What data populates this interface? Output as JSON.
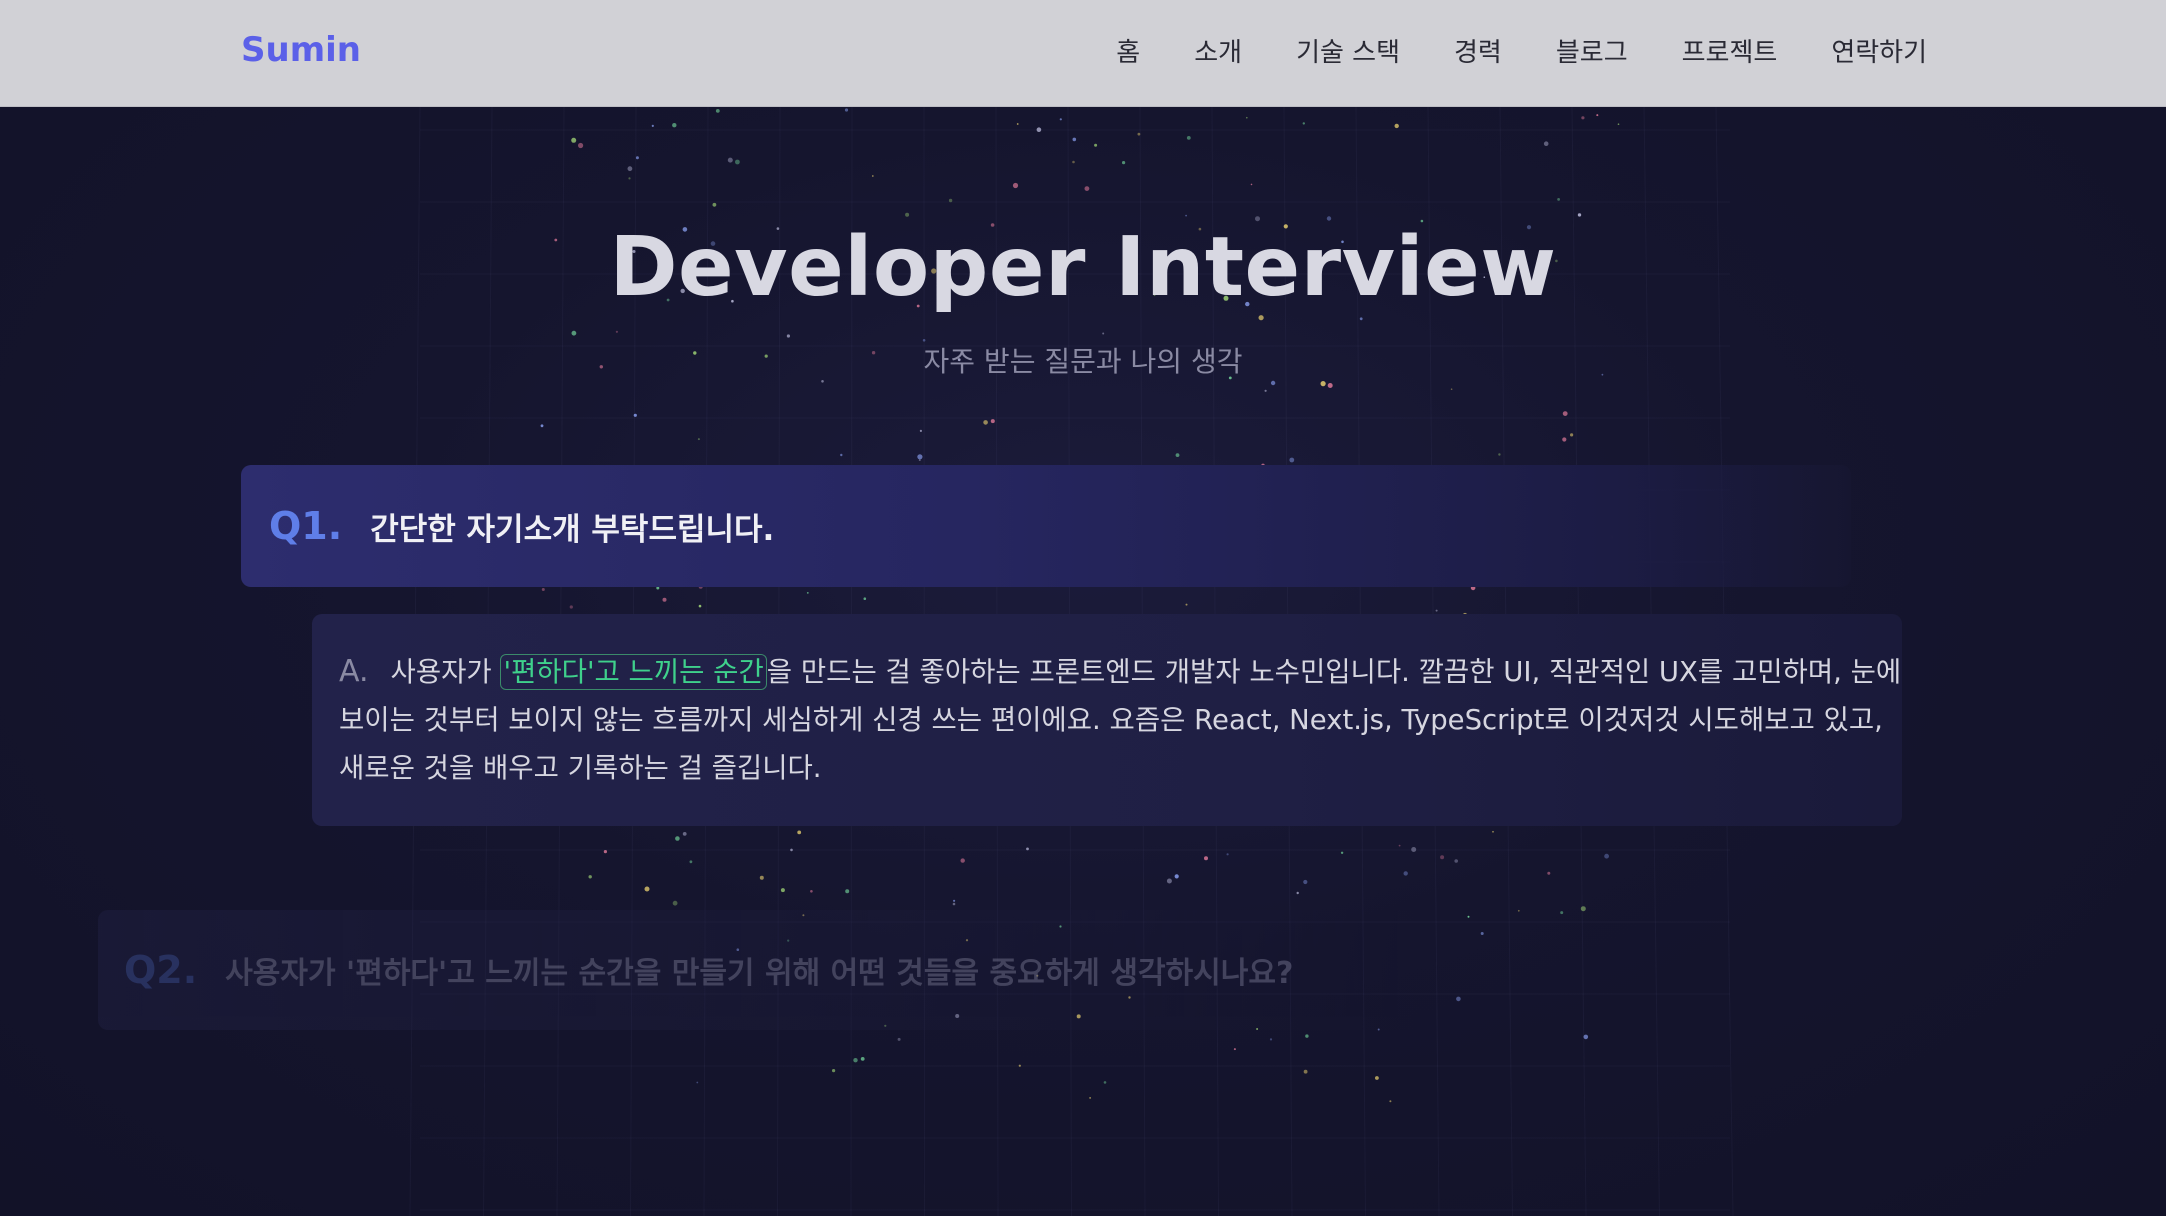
{
  "nav": {
    "brand": "Sumin",
    "links": [
      "홈",
      "소개",
      "기술 스택",
      "경력",
      "블로그",
      "프로젝트",
      "연락하기"
    ]
  },
  "hero": {
    "title": "Developer Interview",
    "subtitle": "자주 받는 질문과 나의 생각"
  },
  "q1": {
    "number": "Q1.",
    "question": "간단한 자기소개 부탁드립니다.",
    "answer_label": "A.",
    "answer_prefix": "사용자가 ",
    "answer_highlight": "'편하다'고 느끼는 순간",
    "answer_rest": "을 만드는 걸 좋아하는 프론트엔드 개발자 노수민입니다. 깔끔한 UI, 직관적인 UX를 고민하며, 눈에 보이는 것부터 보이지 않는 흐름까지 세심하게 신경 쓰는 편이에요. 요즘은 React, Next.js, TypeScript로 이것저것 시도해보고 있고, 새로운 것을 배우고 기록하는 걸 즐깁니다."
  },
  "q2": {
    "number": "Q2.",
    "question": "사용자가 '편하다'고 느끼는 순간을 만들기 위해 어떤 것들을 중요하게 생각하시나요?"
  },
  "colors": {
    "brand": "#5b60e8",
    "accent_question": "#5f7ee8",
    "highlight": "#3fd18c",
    "background": "#13132a"
  }
}
